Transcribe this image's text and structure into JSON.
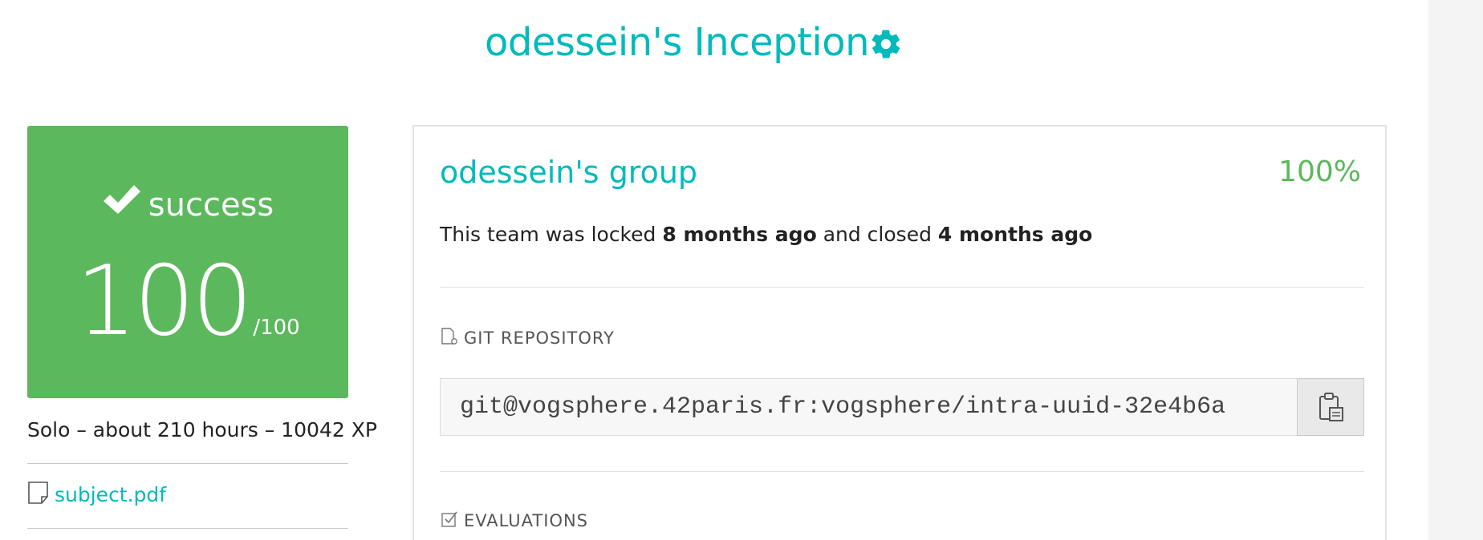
{
  "header": {
    "title": "odessein's Inception",
    "settings_icon": "gear-icon",
    "accent_color": "#00babc"
  },
  "score_card": {
    "status_icon": "check-icon",
    "status": "success",
    "score": "100",
    "max_score": "/100",
    "color": "#5cb85c"
  },
  "project_meta": {
    "summary": "Solo – about 210 hours – 10042 XP"
  },
  "attachments": {
    "subject_icon": "file-icon",
    "subject_label": "subject.pdf"
  },
  "team_panel": {
    "group_name": "odessein's group",
    "percentage": "100%",
    "percentage_color": "#5cb85c",
    "lock_text": {
      "prefix": "This team was locked ",
      "locked_ago": "8 months ago",
      "middle": " and closed ",
      "closed_ago": "4 months ago"
    },
    "git_section": {
      "label": "GIT REPOSITORY",
      "icon": "git-file-icon",
      "repo_url": "git@vogsphere.42paris.fr:vogsphere/intra-uuid-32e4b6a",
      "copy_icon": "clipboard-icon"
    },
    "evaluations_section": {
      "label": "EVALUATIONS",
      "icon": "checkbox-icon"
    }
  }
}
